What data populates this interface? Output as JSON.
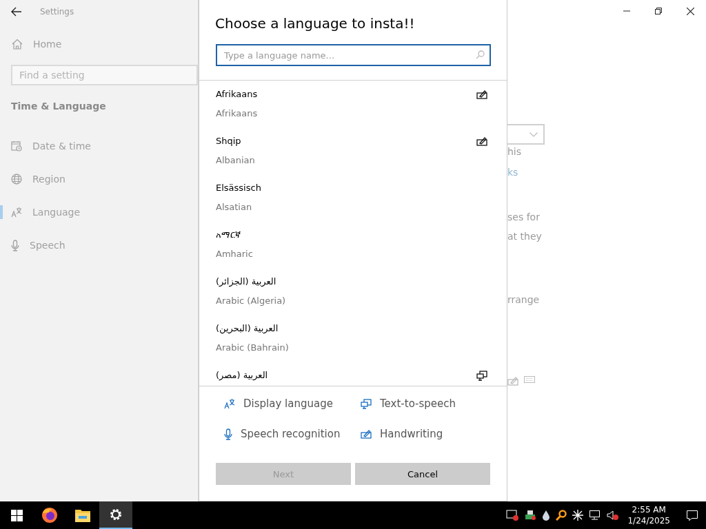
{
  "settings_window": {
    "title": "Settings",
    "home": "Home",
    "search": {
      "placeholder": "Find a setting"
    },
    "section": "Time & Language",
    "nav_items": [
      {
        "kind": "date",
        "label": "Date & time",
        "selected": false
      },
      {
        "kind": "region",
        "label": "Region",
        "selected": false
      },
      {
        "kind": "language",
        "label": "Language",
        "selected": true
      },
      {
        "kind": "speech",
        "label": "Speech",
        "selected": false
      }
    ],
    "content_fragments": [
      {
        "kind": "dropdown"
      },
      {
        "kind": "text",
        "text": "his"
      },
      {
        "kind": "link",
        "text": "ks"
      },
      {
        "kind": "text",
        "text": "ses for"
      },
      {
        "kind": "text",
        "text": "at they"
      },
      {
        "kind": "text",
        "text": "rrange"
      },
      {
        "kind": "icons"
      }
    ]
  },
  "dialog": {
    "title": "Choose a language to insta!!",
    "search": {
      "placeholder": "Type a language name..."
    },
    "languages": [
      {
        "native": "Afrikaans",
        "english": "Afrikaans",
        "handwriting": true
      },
      {
        "native": "Shqip",
        "english": "Albanian",
        "handwriting": true
      },
      {
        "native": "Elsässisch",
        "english": "Alsatian"
      },
      {
        "native": "አማርኛ",
        "english": "Amharic"
      },
      {
        "native": "العربية (الجزائر)",
        "english": "Arabic (Algeria)"
      },
      {
        "native": "العربية (البحرين)",
        "english": "Arabic (Bahrain)"
      },
      {
        "native": "العربية (مصر)",
        "text_to_speech": true
      }
    ],
    "legend": [
      {
        "kind": "display-language",
        "label": "Display language"
      },
      {
        "kind": "text-to-speech",
        "label": "Text-to-speech"
      },
      {
        "kind": "speech",
        "label": "Speech recognition"
      },
      {
        "kind": "handwriting",
        "label": "Handwriting"
      }
    ],
    "buttons": [
      {
        "label": "Next",
        "disabled": true
      },
      {
        "label": "Cancel",
        "disabled": false
      }
    ]
  },
  "taskbar": {
    "apps": [
      {
        "kind": "firefox",
        "selected": false
      },
      {
        "kind": "explorer",
        "selected": false
      },
      {
        "kind": "settings",
        "selected": true
      }
    ],
    "time": "2:55 AM",
    "date": "1/24/2025"
  }
}
